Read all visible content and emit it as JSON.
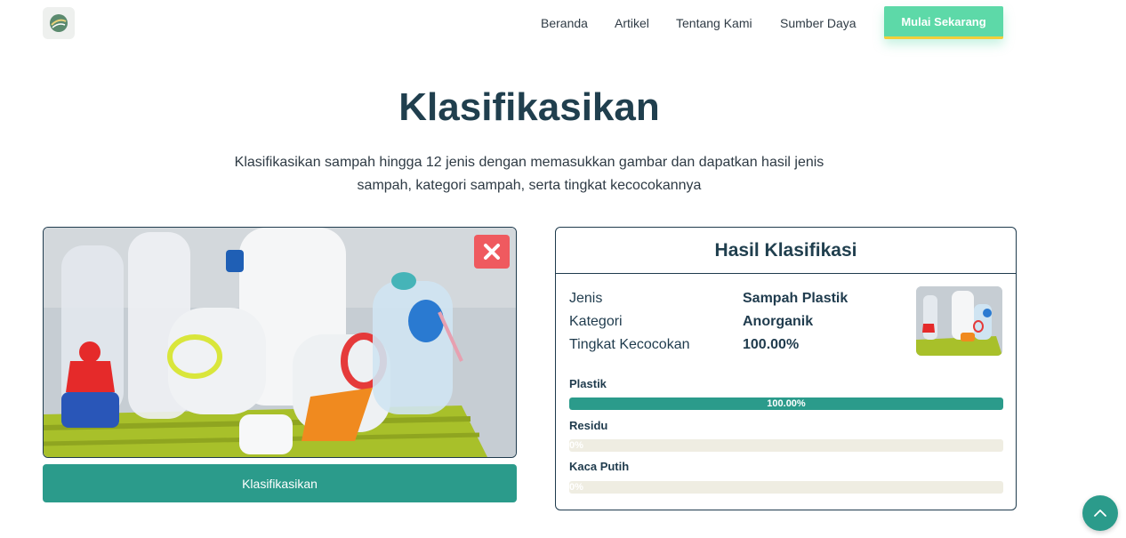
{
  "header": {
    "logo_icon": "leaf-globe-icon",
    "nav": [
      {
        "label": "Beranda"
      },
      {
        "label": "Artikel"
      },
      {
        "label": "Tentang Kami"
      },
      {
        "label": "Sumber Daya"
      }
    ],
    "cta_label": "Mulai Sekarang"
  },
  "hero": {
    "title": "Klasifikasikan",
    "description_line1": "Klasifikasikan sampah hingga 12 jenis dengan memasukkan gambar dan dapatkan hasil jenis",
    "description_line2": "sampah, kategori sampah, serta tingkat kecocokannya"
  },
  "upload": {
    "image_alt": "plastic bottles in a basket",
    "close_icon": "close-icon",
    "classify_label": "Klasifikasikan"
  },
  "result": {
    "title": "Hasil Klasifikasi",
    "rows": [
      {
        "label": "Jenis",
        "value": "Sampah Plastik"
      },
      {
        "label": "Kategori",
        "value": "Anorganik"
      },
      {
        "label": "Tingkat Kecocokan",
        "value": "100.00%"
      }
    ],
    "bars": [
      {
        "label": "Plastik",
        "percent": 100,
        "text": "100.00%"
      },
      {
        "label": "Residu",
        "percent": 0,
        "text": "0%"
      },
      {
        "label": "Kaca Putih",
        "percent": 0,
        "text": "0%"
      }
    ]
  },
  "colors": {
    "accent": "#2b9b8b",
    "cta": "#5dd9a8",
    "close": "#ef5a5f",
    "heading": "#203f4e"
  },
  "scroll_top_icon": "chevron-up-icon"
}
